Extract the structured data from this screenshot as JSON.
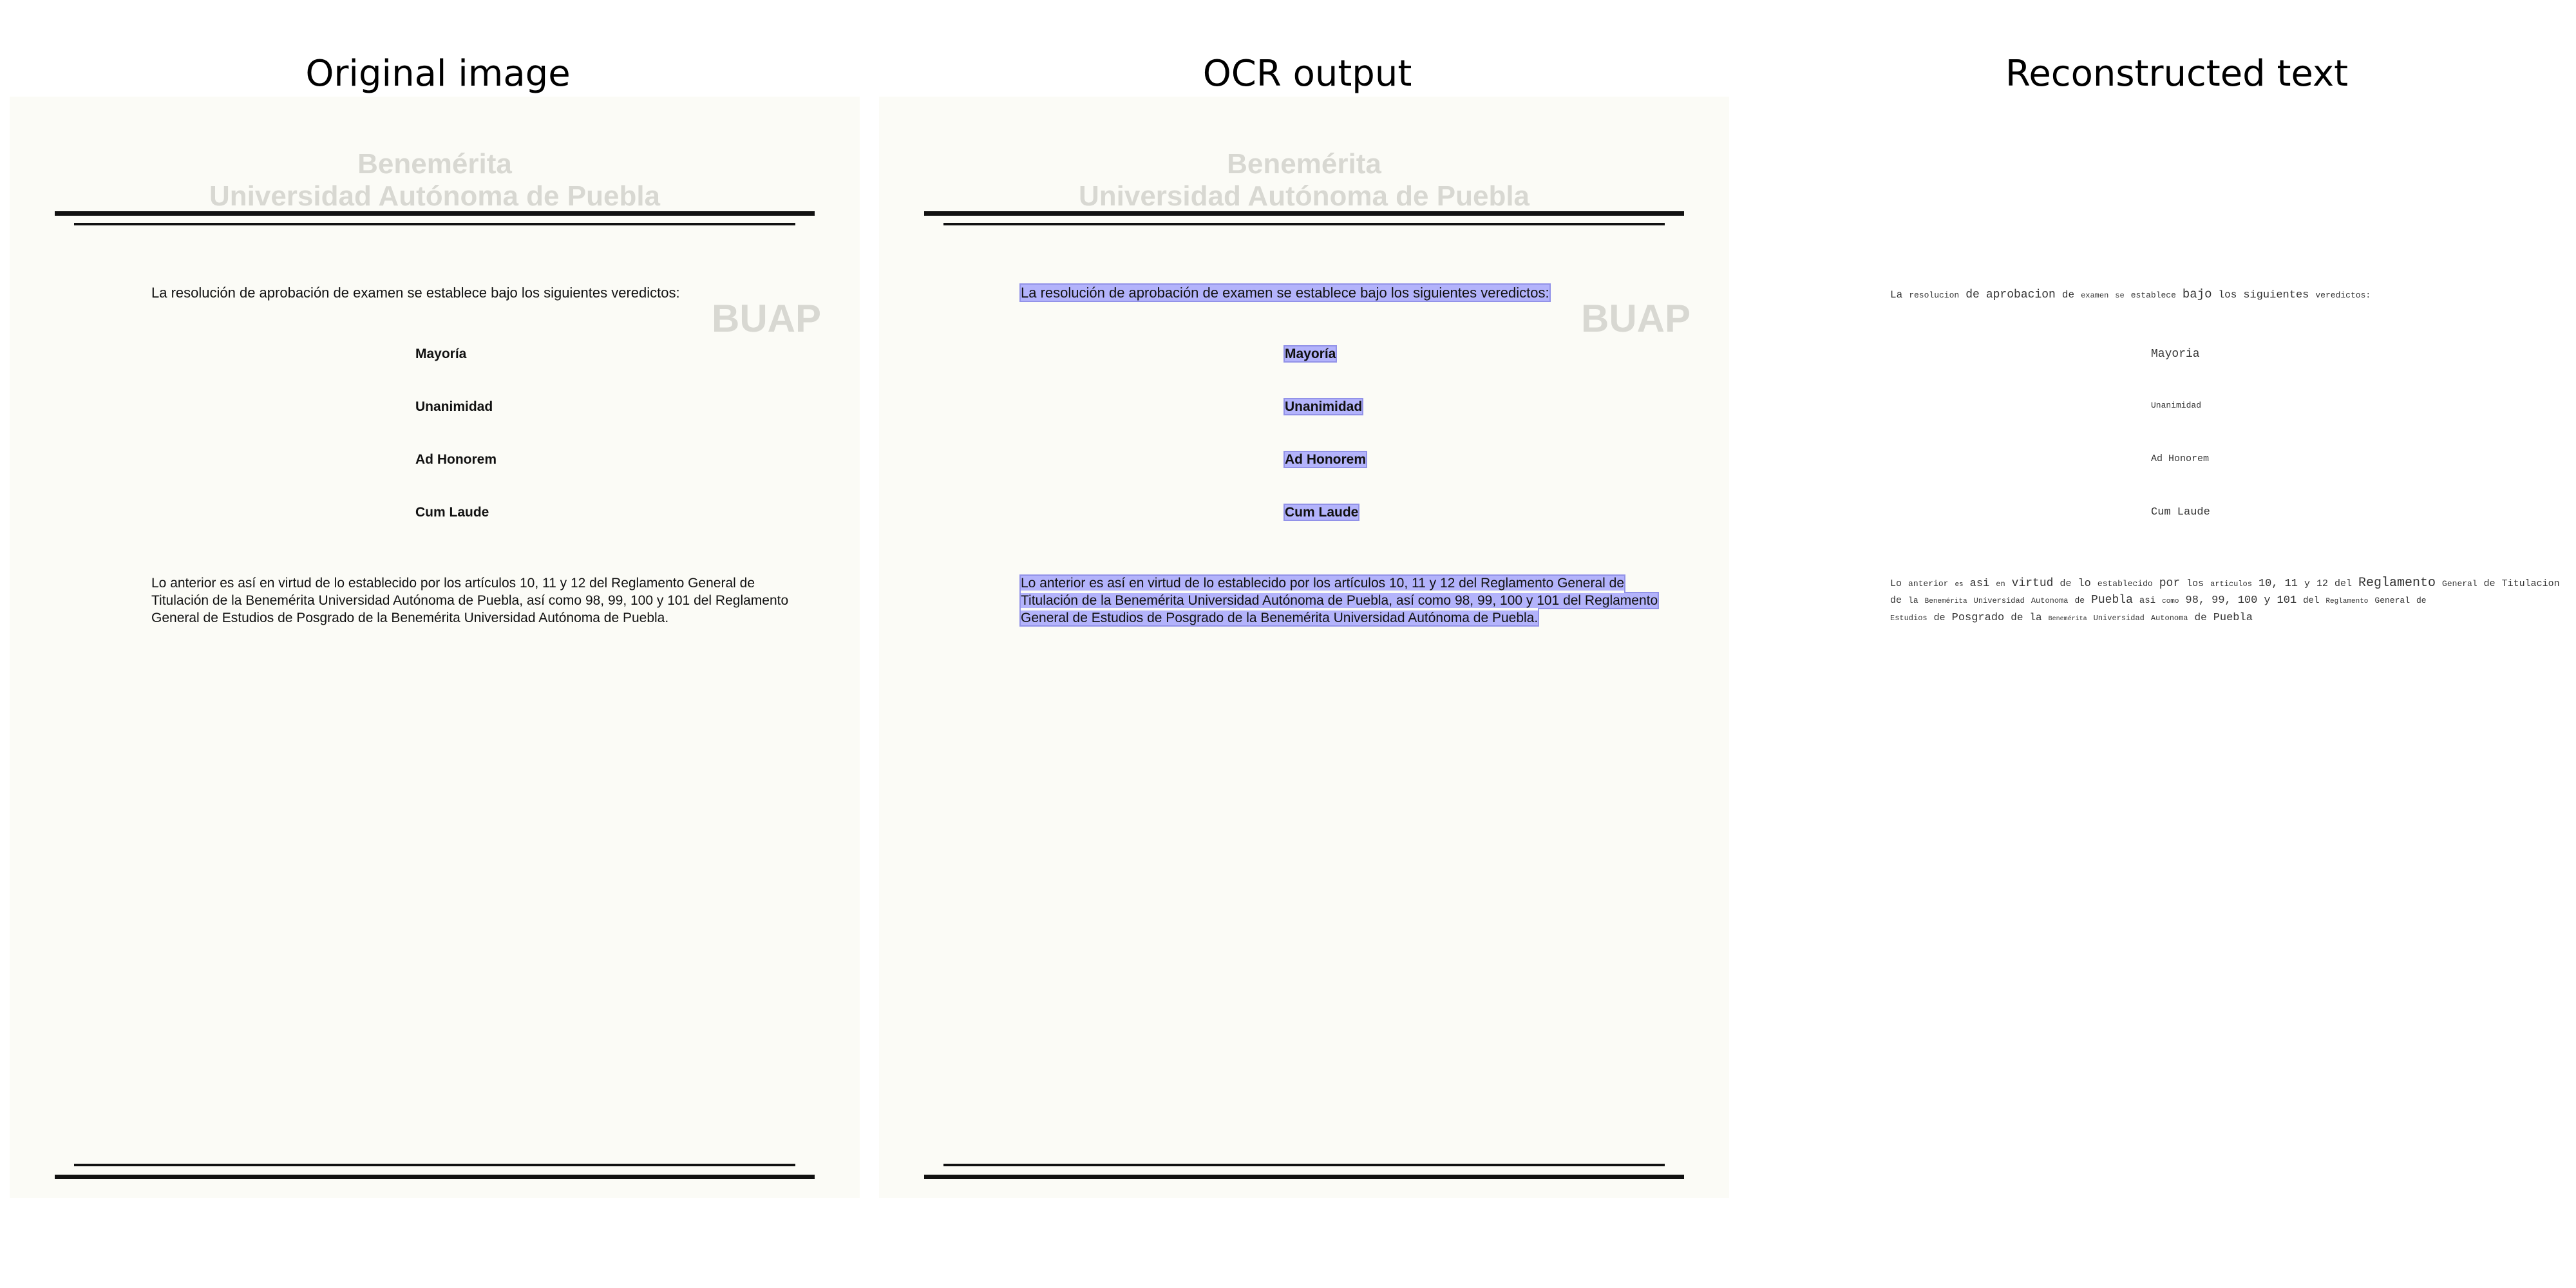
{
  "panels": {
    "original_title": "Original image",
    "ocr_title": "OCR output",
    "reconstructed_title": "Reconstructed text"
  },
  "document": {
    "ghost_header_1": "Benemérita",
    "ghost_header_2": "Universidad Autónoma de Puebla",
    "ghost_logo": "BUAP",
    "intro": "La resolución de aprobación de examen se establece bajo los siguientes veredictos:",
    "verdicts": [
      "Mayoría",
      "Unanimidad",
      "Ad Honorem",
      "Cum Laude"
    ],
    "closing": "Lo anterior es así en virtud de lo establecido por los artículos 10, 11 y 12 del Reglamento General de Titulación de la Benemérita Universidad Autónoma de Puebla, así como 98, 99, 100 y 101 del Reglamento General de Estudios de Posgrado de la Benemérita Universidad Autónoma de Puebla."
  },
  "reconstructed": {
    "intro_words": [
      "La",
      "resolucion",
      "de",
      "aprobacion",
      "de",
      "examen",
      "se",
      "establece",
      "bajo",
      "los",
      "siguientes",
      "veredictos:"
    ],
    "verdicts": [
      "Mayoria",
      "Unanimidad",
      "Ad Honorem",
      "Cum Laude"
    ],
    "closing_line1": [
      "Lo",
      "anterior",
      "es",
      "asi",
      "en",
      "virtud",
      "de",
      "lo",
      "establecido",
      "por",
      "los",
      "articulos",
      "10,",
      "11",
      "y",
      "12",
      "del",
      "Reglamento",
      "General",
      "de",
      "Titulacion"
    ],
    "closing_line2": [
      "de",
      "la",
      "Benemérita",
      "Universidad",
      "Autonoma",
      "de",
      "Puebla",
      "asi",
      "como",
      "98,",
      "99,",
      "100",
      "y",
      "101",
      "del",
      "Reglamento",
      "General",
      "de"
    ],
    "closing_line3": [
      "Estudios",
      "de",
      "Posgrado",
      "de",
      "la",
      "Benemérita",
      "Universidad",
      "Autonoma",
      "de",
      "Puebla"
    ]
  }
}
